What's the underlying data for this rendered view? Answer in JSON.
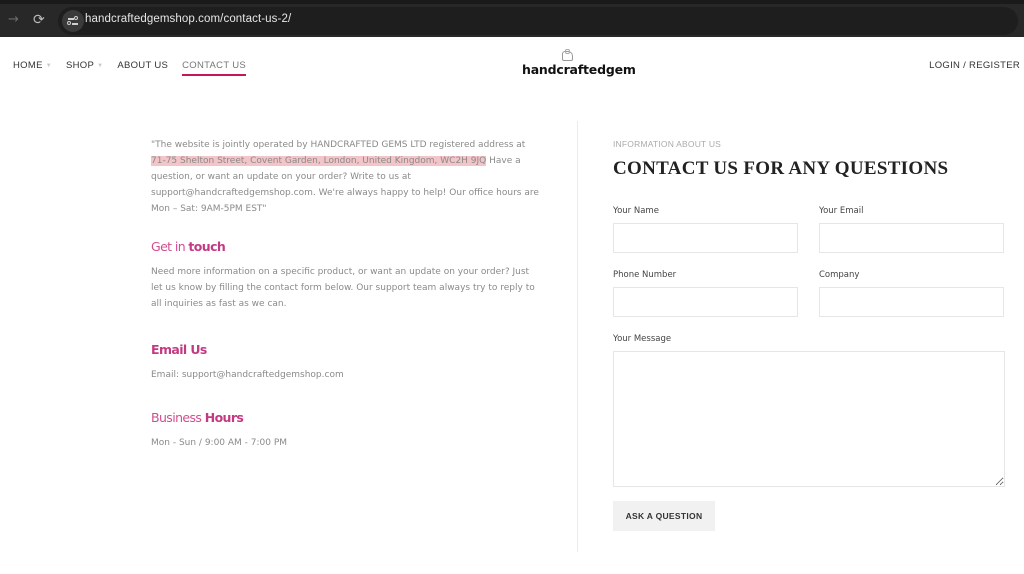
{
  "browser": {
    "url": "handcraftedgemshop.com/contact-us-2/",
    "icons": {
      "forward": "arrow-right",
      "reload": "reload",
      "site_info": "tune-sliders"
    }
  },
  "header": {
    "nav": [
      {
        "label": "HOME",
        "has_dropdown": true,
        "active": false
      },
      {
        "label": "SHOP",
        "has_dropdown": true,
        "active": false
      },
      {
        "label": "ABOUT US",
        "has_dropdown": false,
        "active": false
      },
      {
        "label": "CONTACT US",
        "has_dropdown": false,
        "active": true
      }
    ],
    "logo_text": "handcraftedgem",
    "login_label": "LOGIN / REGISTER",
    "accent_color": "#c2185b"
  },
  "left": {
    "intro_before": "\"The website is jointly operated by HANDCRAFTED GEMS LTD registered address at ",
    "intro_highlight": "71-75 Shelton Street, Covent Garden, London, United Kingdom, WC2H 9JQ",
    "intro_after": " Have a question, or want an update on your order? Write to us at support@handcraftedgemshop.com. We're always happy to help! Our office hours are Mon – Sat: 9AM-5PM EST\"",
    "get_in_touch": {
      "light": "Get in ",
      "bold": "touch"
    },
    "get_in_touch_body": "Need more information on a specific product, or want an update on your order? Just let us know by filling the contact form below. Our support team always try to reply to all inquiries as fast as we can.",
    "email_heading": "Email Us",
    "email_body": "Email: support@handcraftedgemshop.com",
    "hours_heading": {
      "light": "Business ",
      "bold": "Hours"
    },
    "hours_body": "Mon - Sun / 9:00 AM - 7:00 PM",
    "heading_color": "#c33a82",
    "highlight_color": "#f3c4c8"
  },
  "form": {
    "eyebrow": "INFORMATION ABOUT US",
    "title": "CONTACT US FOR ANY QUESTIONS",
    "fields": {
      "name": {
        "label": "Your Name",
        "value": ""
      },
      "email": {
        "label": "Your Email",
        "value": ""
      },
      "phone": {
        "label": "Phone Number",
        "value": ""
      },
      "company": {
        "label": "Company",
        "value": ""
      },
      "message": {
        "label": "Your Message",
        "value": ""
      }
    },
    "submit_label": "ASK A QUESTION"
  }
}
